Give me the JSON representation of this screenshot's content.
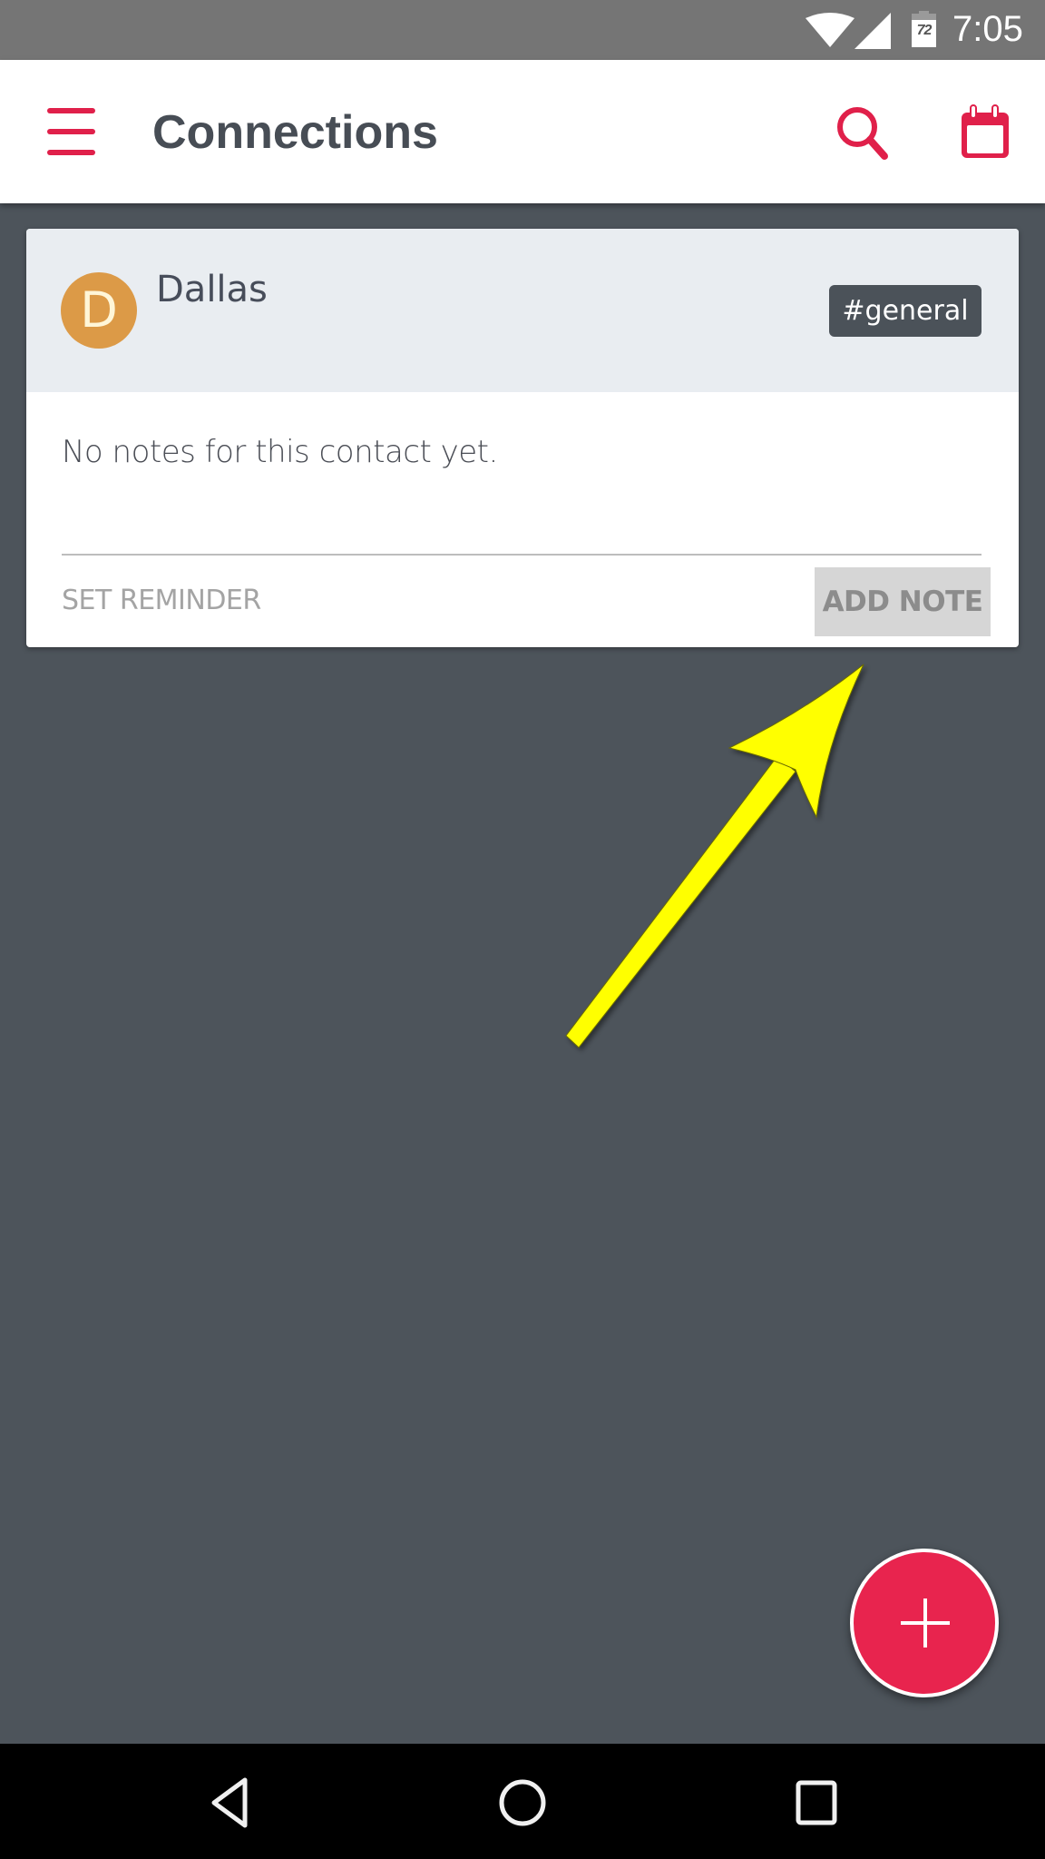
{
  "status_bar": {
    "time": "7:05",
    "battery_level": "72",
    "icons": [
      "wifi-icon",
      "cellular-signal-icon",
      "battery-icon"
    ]
  },
  "app_bar": {
    "title": "Connections",
    "icons": [
      "menu-icon",
      "search-icon",
      "calendar-icon"
    ],
    "accent_color": "#e8244e"
  },
  "contact_card": {
    "avatar_initial": "D",
    "avatar_color": "#dc9a47",
    "name": "Dallas",
    "tag": "#general",
    "notes_text": "No notes for this contact yet.",
    "actions": {
      "set_reminder_label": "SET REMINDER",
      "add_note_label": "ADD NOTE"
    }
  },
  "annotation": {
    "type": "arrow",
    "color": "#ffff00",
    "points_to": "add-note-button"
  },
  "fab": {
    "icon": "plus-icon",
    "color": "#e8244e"
  },
  "nav_bar": {
    "buttons": [
      "back-icon",
      "home-icon",
      "recents-icon"
    ]
  }
}
